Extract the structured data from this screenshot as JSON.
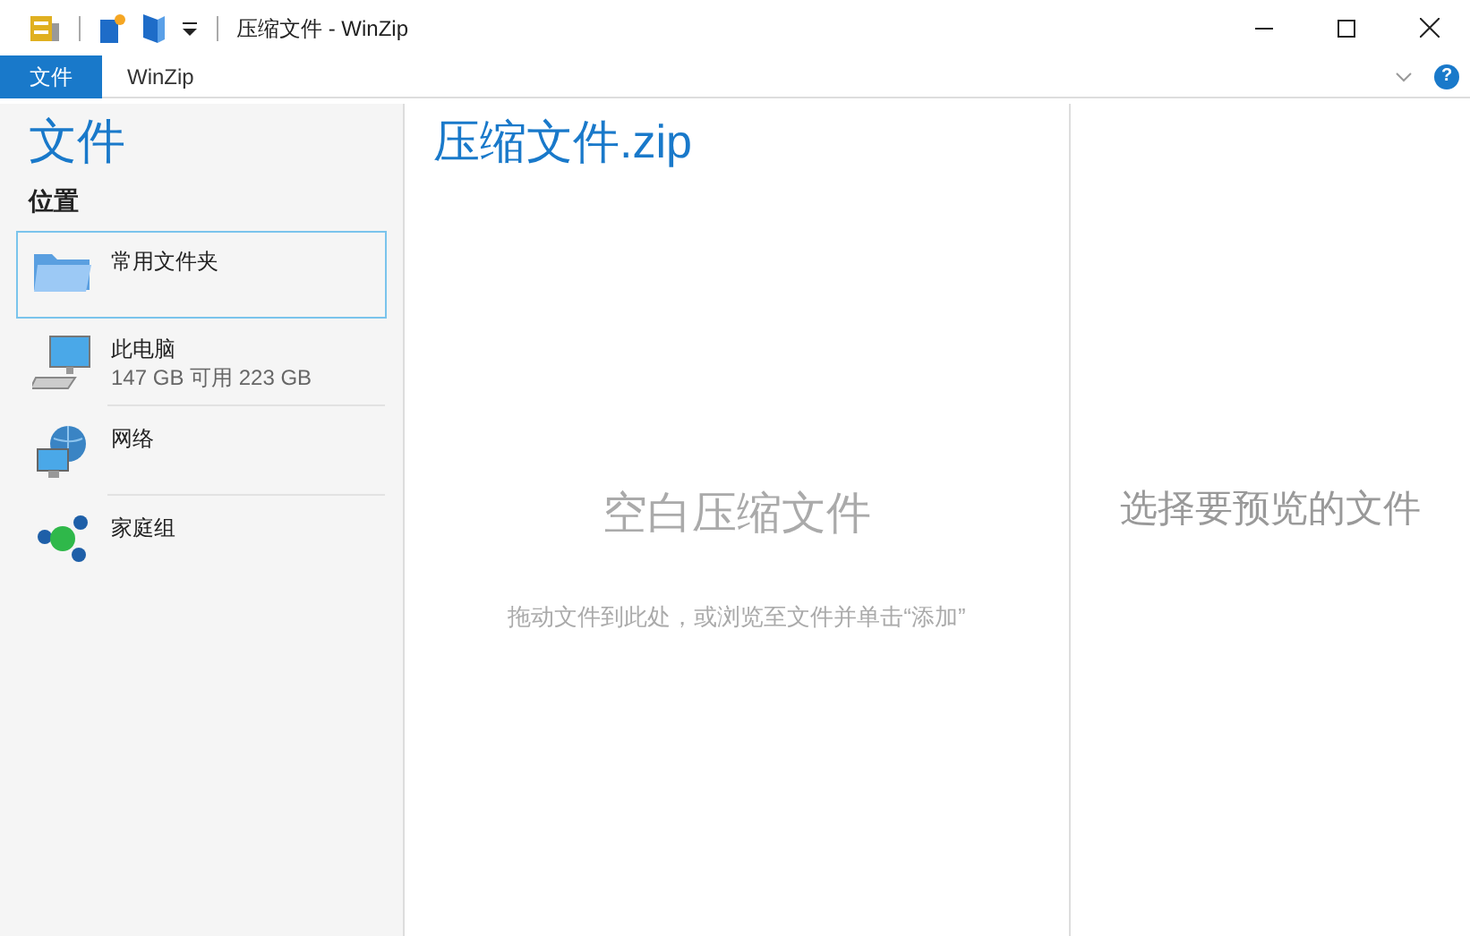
{
  "window": {
    "title": "压缩文件 - WinZip"
  },
  "ribbon": {
    "tabs": [
      {
        "label": "文件",
        "selected": true
      },
      {
        "label": "WinZip",
        "selected": false
      }
    ],
    "help": "?"
  },
  "sidebar": {
    "heading": "文件",
    "section": "位置",
    "items": [
      {
        "kind": "folder",
        "label": "常用文件夹",
        "selected": true
      },
      {
        "kind": "computer",
        "label": "此电脑",
        "detail": "147 GB 可用 223 GB",
        "selected": false
      },
      {
        "kind": "network",
        "label": "网络",
        "selected": false
      },
      {
        "kind": "homegroup",
        "label": "家庭组",
        "selected": false
      }
    ]
  },
  "archive": {
    "title": "压缩文件.zip",
    "empty_title": "空白压缩文件",
    "hint": "拖动文件到此处，或浏览至文件并单击“添加”"
  },
  "preview": {
    "message": "选择要预览的文件"
  }
}
